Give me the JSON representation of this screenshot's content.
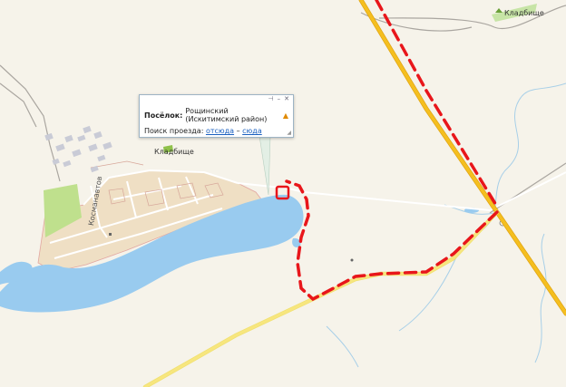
{
  "labels": {
    "cemetery_top": "Кладбище",
    "cemetery_village": "Кладбище",
    "street": "Косманавтов"
  },
  "popup": {
    "type_label": "Посёлок:",
    "place_name": "Рощинский (Искитимский район)",
    "warning_icon": "warning-triangle-icon",
    "route_label": "Поиск проезда:",
    "from_link": "отсюда",
    "separator": "–",
    "to_link": "сюда",
    "controls": [
      "pin-icon",
      "minimize-icon",
      "close-icon"
    ],
    "control_glyphs": [
      "⊣",
      "–",
      "✕"
    ],
    "resize_glyph": "◢"
  },
  "colors": {
    "background": "#f6f3ea",
    "water": "#99cbef",
    "settlement": "#efdfc4",
    "park": "#bfe08d",
    "highway": "#f5bf1f",
    "route": "#e8161b",
    "road": "#ffffff",
    "building": "#c9cbd6"
  }
}
